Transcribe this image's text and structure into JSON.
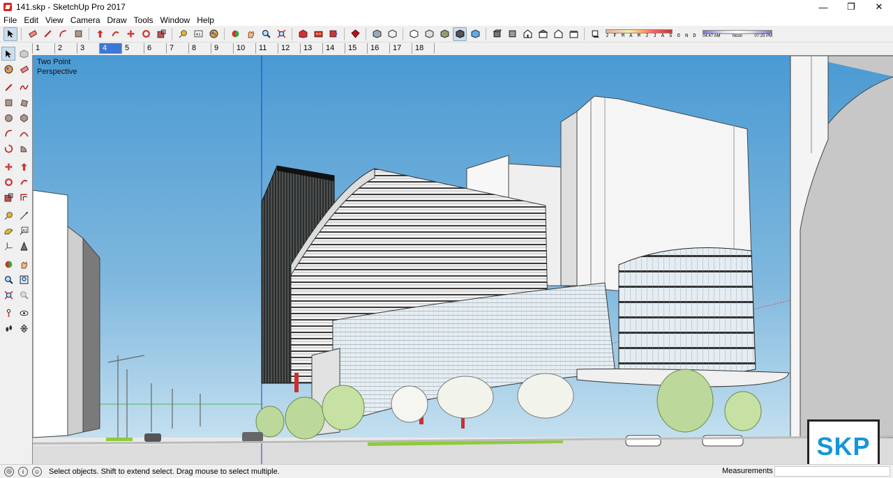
{
  "window": {
    "title": "141.skp - SketchUp Pro 2017",
    "minimize": "—",
    "restore": "❐",
    "close": "✕"
  },
  "menu": [
    "File",
    "Edit",
    "View",
    "Camera",
    "Draw",
    "Tools",
    "Window",
    "Help"
  ],
  "toolbar": {
    "shadow_months": "J F M A M J J A S O N D",
    "time_start": "04:47 AM",
    "time_mid": "Noon",
    "time_end": "07:25 PM"
  },
  "scenes": {
    "tabs": [
      "1",
      "2",
      "3",
      "4",
      "5",
      "6",
      "7",
      "8",
      "9",
      "10",
      "11",
      "12",
      "13",
      "14",
      "15",
      "16",
      "17",
      "18"
    ],
    "active": "4"
  },
  "viewport": {
    "camera_label_line1": "Two Point",
    "camera_label_line2": "Perspective",
    "badge": "SKP",
    "sky_top": "#4a9ad3",
    "sky_bottom": "#cfe6f2"
  },
  "status": {
    "message": "Select objects. Shift to extend select. Drag mouse to select multiple.",
    "measurements_label": "Measurements",
    "measurements_value": ""
  }
}
